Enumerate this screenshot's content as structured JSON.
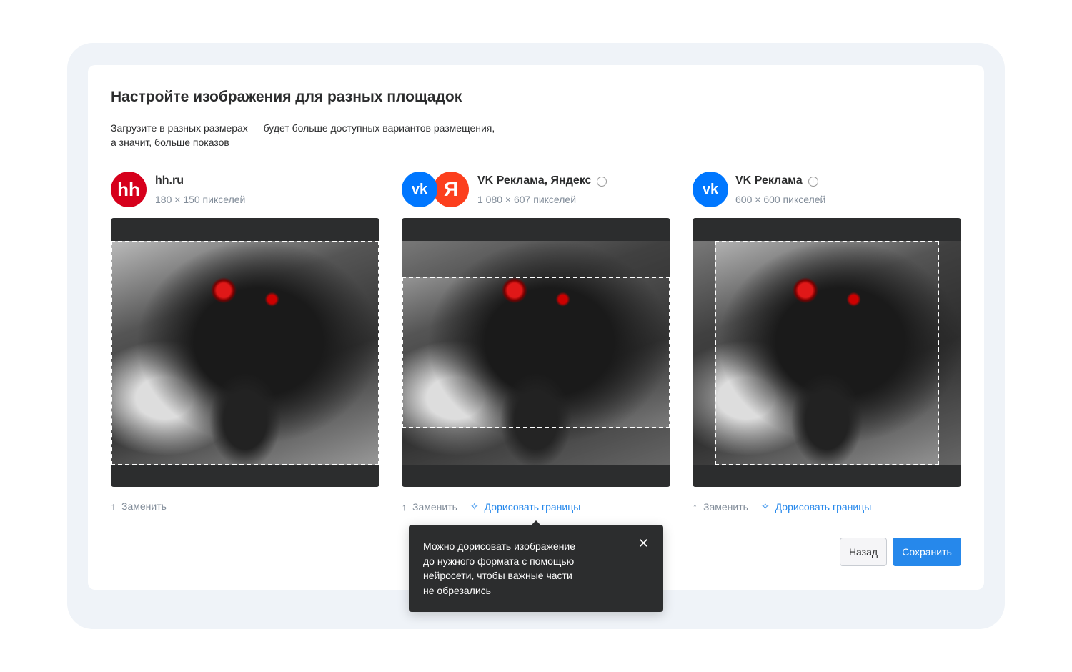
{
  "title": "Настройте изображения для разных площадок",
  "subtitle": [
    "Загрузите в разных размерах — будет больше доступных вариантов размещения,",
    "а значит, больше показов"
  ],
  "platforms": [
    {
      "name": "hh.ru",
      "size": "180 × 150 пикселей",
      "logos": [
        "hh"
      ],
      "replace": "Заменить"
    },
    {
      "name": "VK Реклама, Яндекс",
      "size": "1 080 × 607 пикселей",
      "logos": [
        "vk",
        "Я"
      ],
      "replace": "Заменить",
      "extend": "Дорисовать границы"
    },
    {
      "name": "VK Реклама",
      "size": "600 × 600 пикселей",
      "logos": [
        "vk"
      ],
      "replace": "Заменить",
      "extend": "Дорисовать границы"
    }
  ],
  "tooltip": {
    "lines": [
      "Можно дорисовать изображение",
      "до нужного формата с помощью",
      "нейросети, чтобы важные части",
      "не обрезались"
    ],
    "close": "✕"
  },
  "buttons": {
    "back": "Назад",
    "save": "Сохранить"
  },
  "info_icon": "i",
  "colors": {
    "accent": "#2688eb",
    "hh": "#d6001c",
    "vk": "#0077ff",
    "yandex": "#fc3f1d"
  }
}
